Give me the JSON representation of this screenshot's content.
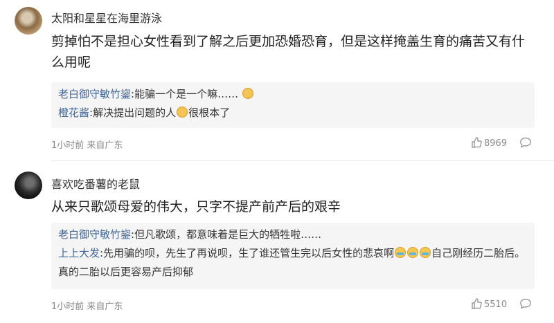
{
  "comments": [
    {
      "username": "太阳和星星在海里游泳",
      "content": "剪掉怕不是担心女性看到了解之后更加恐婚恐育，但是这样掩盖生育的痛苦又有什么用呢",
      "replies": [
        {
          "user": "老白御守敏竹鋆",
          "sep": ":",
          "text": "能骗一个是一个嘛……",
          "tail": ""
        },
        {
          "user": "橙花酱",
          "sep": ":",
          "text": "解决提出问题的人",
          "tail": "很根本了"
        }
      ],
      "meta": "1小时前 来自广东",
      "likes": "8969"
    },
    {
      "username": "喜欢吃番薯的老鼠",
      "content": "从来只歌颂母爱的伟大，只字不提产前产后的艰辛",
      "replies": [
        {
          "user": "老白御守敏竹鋆",
          "sep": ":",
          "text": "但凡歌颂，都意味着是巨大的牺牲啦……",
          "tail": ""
        },
        {
          "user": "上上大发",
          "sep": ":",
          "text": "先用骗的呗，先生了再说呗，生了谁还管生完以后女性的悲哀啊",
          "tail": "自己刚经历二胎后。真的二胎以后更容易产后抑郁"
        }
      ],
      "meta": "1小时前 来自广东",
      "likes": "5510"
    }
  ],
  "icons": {
    "like": "thumbs-up-icon",
    "reply": "comment-bubble-icon",
    "emoji_smile": "doge-emoji-icon",
    "emoji_cry": "crying-emoji-icon"
  },
  "colors": {
    "reply_user": "#406599",
    "reply_bg": "#f5f5f5",
    "meta": "#888888"
  }
}
